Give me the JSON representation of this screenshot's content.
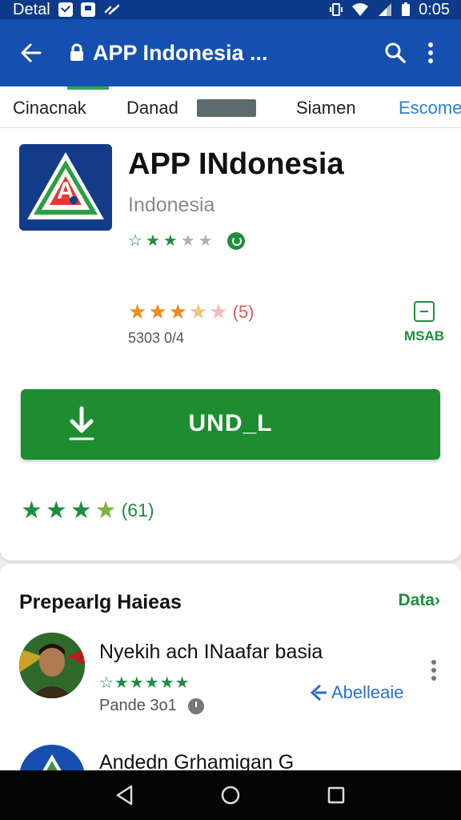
{
  "status_bar": {
    "left_text": "Detal",
    "time": "0:05"
  },
  "app_bar": {
    "title": "APP Indonesia ..."
  },
  "tabs": [
    "Cinacnak",
    "Danad",
    "Siamen",
    "Escome"
  ],
  "app": {
    "name": "APP INdonesia",
    "developer": "Indonesia",
    "rating_value": "(5)",
    "downloads": "5303 0/4",
    "side_label": "MSAB",
    "install_label": "UND_L",
    "bottom_rating_count": "(61)"
  },
  "reviews_section": {
    "title": "Prepearlg Haieas",
    "link": "Data",
    "reviews": [
      {
        "name": "Nyekih ach INaafar basia",
        "stars": "☆★★★★★",
        "meta": "Pande 3o1",
        "action": "Abelleaie"
      },
      {
        "name": "Andedn Grhamigan G"
      }
    ]
  },
  "colors": {
    "app_bar": "#1550b0",
    "status_bar": "#0d3a8a",
    "install": "#1d8d2f",
    "accent_green": "#1e8e3e",
    "tab_active": "#2a7fd4"
  },
  "icons": [
    "back-arrow-icon",
    "lock-icon",
    "search-icon",
    "more-vert-icon",
    "download-icon",
    "clock-icon",
    "nav-back-icon",
    "nav-home-icon",
    "nav-recents-icon"
  ]
}
